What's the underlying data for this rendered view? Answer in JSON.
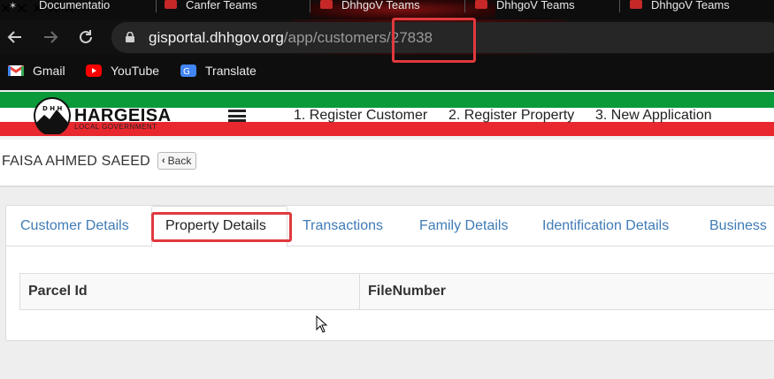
{
  "browser": {
    "tabs": [
      {
        "title": "Documentatio"
      },
      {
        "title": "Canfer Teams"
      },
      {
        "title": "DhhgoV Teams"
      },
      {
        "title": "DhhgoV Teams"
      },
      {
        "title": "DhhgoV Teams"
      }
    ],
    "tab_close_glyph": "✕",
    "url_host": "gisportal.dhhgov.org",
    "url_path": "/app/customers/27838",
    "bookmarks": [
      {
        "label": "Gmail",
        "icon": "gmail-icon"
      },
      {
        "label": "YouTube",
        "icon": "youtube-icon"
      },
      {
        "label": "Translate",
        "icon": "translate-icon"
      }
    ]
  },
  "site": {
    "brand": "HARGEISA",
    "brand_sub": "LOCAL GOVERNMENT",
    "logo_letters": "D H H",
    "nav": [
      {
        "label": "1. Register Customer"
      },
      {
        "label": "2. Register Property"
      },
      {
        "label": "3. New Application"
      }
    ]
  },
  "customer": {
    "name": "FAISA AHMED SAEED",
    "back_label": "Back"
  },
  "detail_tabs": [
    {
      "label": "Customer Details",
      "active": false
    },
    {
      "label": "Property Details",
      "active": true
    },
    {
      "label": "Transactions",
      "active": false
    },
    {
      "label": "Family Details",
      "active": false
    },
    {
      "label": "Identification Details",
      "active": false
    },
    {
      "label": "Business",
      "active": false
    }
  ],
  "property_table": {
    "columns": [
      "Parcel Id",
      "FileNumber"
    ]
  },
  "colors": {
    "flag_green": "#0a9a3a",
    "flag_red": "#e8282e",
    "link_blue": "#3f7bb6",
    "highlight_red": "#e0393e"
  }
}
